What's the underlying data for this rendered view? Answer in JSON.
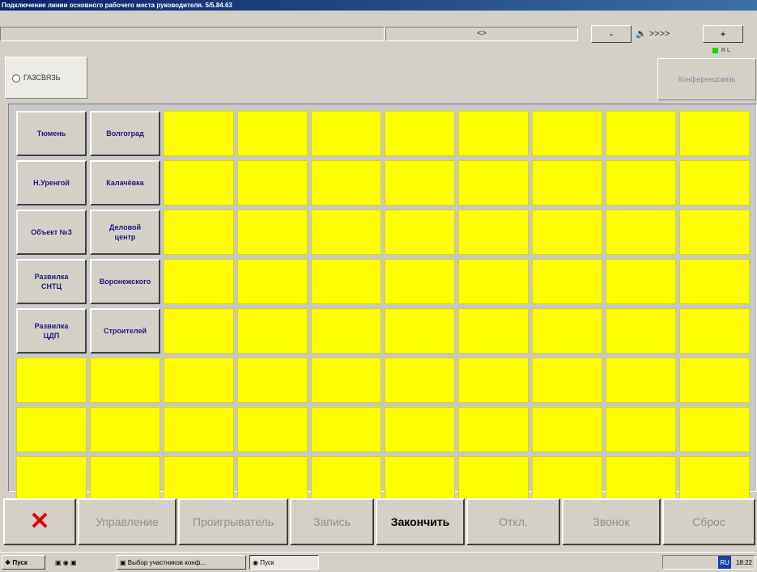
{
  "window": {
    "title": "Подключение линии основного рабочего места руководителя. 5/5.84.63"
  },
  "statusbar": {
    "center_value": "<>",
    "minus_label": "-",
    "speaker_value": ">>>>",
    "plus_label": "+",
    "indicator_text": "R L"
  },
  "mode": {
    "label": "ГАЗСВЯЗЬ"
  },
  "conference": {
    "label": "Конференцсвязь"
  },
  "grid": {
    "columns": 10,
    "rows": 8,
    "named_cells": [
      "Тюмень",
      "Волгоград",
      "Н.Уренгой",
      "Калачёвка",
      "Объект №3",
      "Деловой\nцентр",
      "Развилка\nСНТЦ",
      "Воронежского",
      "Развилка\nЦДП",
      "Строителей"
    ]
  },
  "bottom": {
    "close_icon": "close-x-icon",
    "buttons": [
      "Управление",
      "Проигрыватель",
      "Запись",
      "Закончить",
      "Откл.",
      "Звонок",
      "Сброс"
    ],
    "active_index": 3
  },
  "taskbar": {
    "start": "Пуск",
    "window1": "Выбор участников конф...",
    "window2": "Пуск",
    "lang": "RU",
    "clock": "18:22"
  },
  "colors": {
    "empty_cell": "#ffff00",
    "led": "#19d219",
    "close_icon": "#e00000"
  }
}
